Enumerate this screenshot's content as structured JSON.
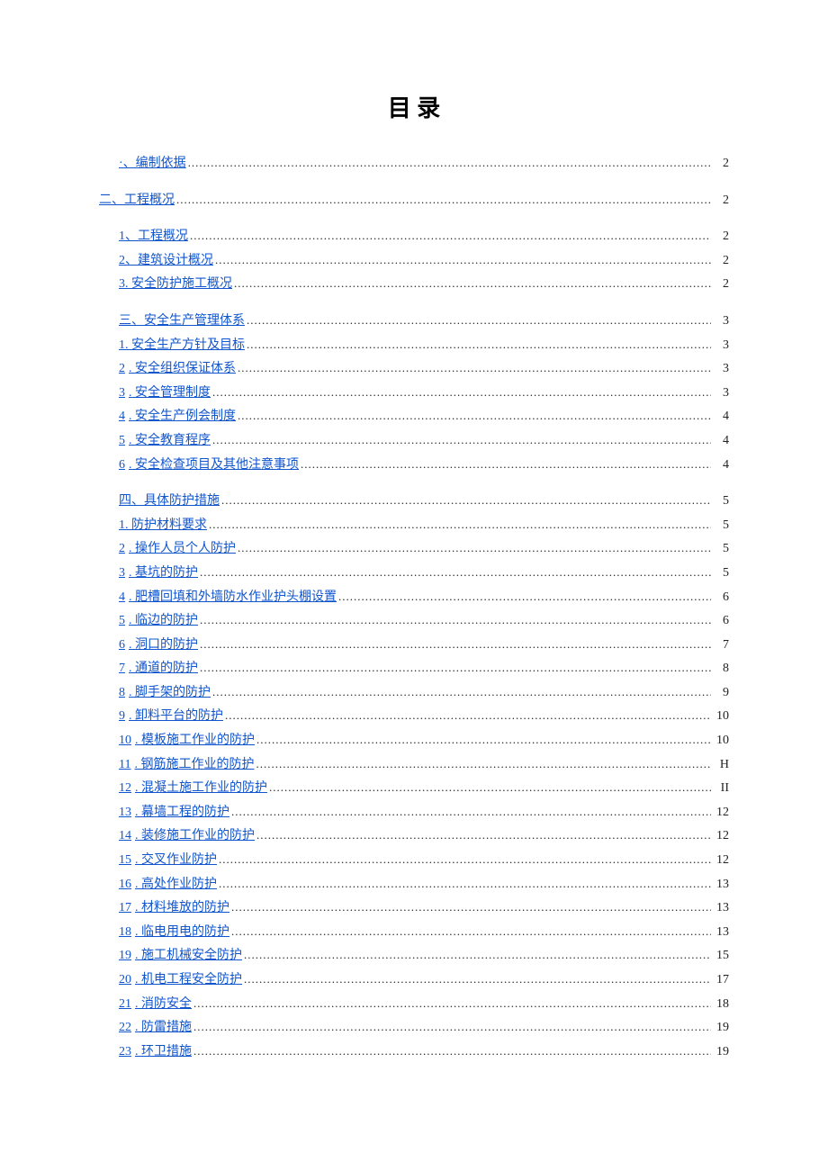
{
  "title": "目 录",
  "toc": [
    {
      "items": [
        {
          "label": "·、编制依据",
          "page": "2",
          "indent": 1
        }
      ]
    },
    {
      "items": [
        {
          "label": "二、工程概况",
          "page": "2",
          "indent": 0
        }
      ]
    },
    {
      "items": [
        {
          "label": "1、工程概况",
          "page": "2",
          "indent": 1
        },
        {
          "label": "2、建筑设计概况",
          "page": "2",
          "indent": 1
        },
        {
          "label": "3. 安全防护施工概况",
          "page": "2",
          "indent": 1
        }
      ]
    },
    {
      "items": [
        {
          "label": "三、安全生产管理体系",
          "page": "3",
          "indent": 1
        },
        {
          "label": "1. 安全生产方针及目标",
          "page": "3",
          "indent": 1
        },
        {
          "num": "2",
          "label": ". 安全组织保证体系",
          "page": "3",
          "indent": 1
        },
        {
          "num": "3",
          "label": ". 安全管理制度",
          "page": "3",
          "indent": 1
        },
        {
          "num": "4",
          "label": ". 安全生产例会制度",
          "page": "4",
          "indent": 1
        },
        {
          "num": "5",
          "label": ". 安全教育程序",
          "page": "4",
          "indent": 1
        },
        {
          "num": "6",
          "label": ". 安全检查项目及其他注意事项",
          "page": "4",
          "indent": 1
        }
      ]
    },
    {
      "items": [
        {
          "label": "四、具体防护措施",
          "page": "5",
          "indent": 1
        },
        {
          "label": "1. 防护材料要求",
          "page": "5",
          "indent": 1
        },
        {
          "num": "2",
          "label": ". 操作人员个人防护",
          "page": "5",
          "indent": 1
        },
        {
          "num": "3",
          "label": ". 基坑的防护",
          "page": "5",
          "indent": 1
        },
        {
          "num": "4",
          "label": ". 肥槽回填和外墙防水作业护头棚设置",
          "page": "6",
          "indent": 1
        },
        {
          "num": "5",
          "label": ". 临边的防护",
          "page": "6",
          "indent": 1
        },
        {
          "num": "6",
          "label": ". 洞口的防护",
          "page": "7",
          "indent": 1
        },
        {
          "num": "7",
          "label": ". 通道的防护",
          "page": "8",
          "indent": 1
        },
        {
          "num": "8",
          "label": ". 脚手架的防护",
          "page": "9",
          "indent": 1
        },
        {
          "num": "9",
          "label": ". 卸料平台的防护",
          "page": "10",
          "indent": 1
        },
        {
          "num": "10",
          "label": ". 模板施工作业的防护",
          "page": "10",
          "indent": 1
        },
        {
          "num": "11",
          "label": ". 钢筋施工作业的防护",
          "page": "H",
          "indent": 1
        },
        {
          "num": "12",
          "label": ". 混凝土施工作业的防护",
          "page": "II",
          "indent": 1
        },
        {
          "num": "13",
          "label": ". 幕墙工程的防护",
          "page": "12",
          "indent": 1
        },
        {
          "num": "14",
          "label": ". 装修施工作业的防护",
          "page": "12",
          "indent": 1
        },
        {
          "num": "15",
          "label": ". 交叉作业防护",
          "page": "12",
          "indent": 1
        },
        {
          "num": "16",
          "label": ". 高处作业防护",
          "page": "13",
          "indent": 1
        },
        {
          "num": "17",
          "label": ". 材料堆放的防护",
          "page": "13",
          "indent": 1
        },
        {
          "num": "18",
          "label": ". 临电用电的防护",
          "page": "13",
          "indent": 1
        },
        {
          "num": "19",
          "label": ". 施工机械安全防护",
          "page": "15",
          "indent": 1
        },
        {
          "num": "20",
          "label": ". 机电工程安全防护",
          "page": "17",
          "indent": 1
        },
        {
          "num": "21",
          "label": ". 消防安全",
          "page": "18",
          "indent": 1
        },
        {
          "num": "22",
          "label": ". 防雷措施",
          "page": "19",
          "indent": 1
        },
        {
          "num": "23",
          "label": ". 环卫措施",
          "page": "19",
          "indent": 1
        }
      ]
    }
  ]
}
